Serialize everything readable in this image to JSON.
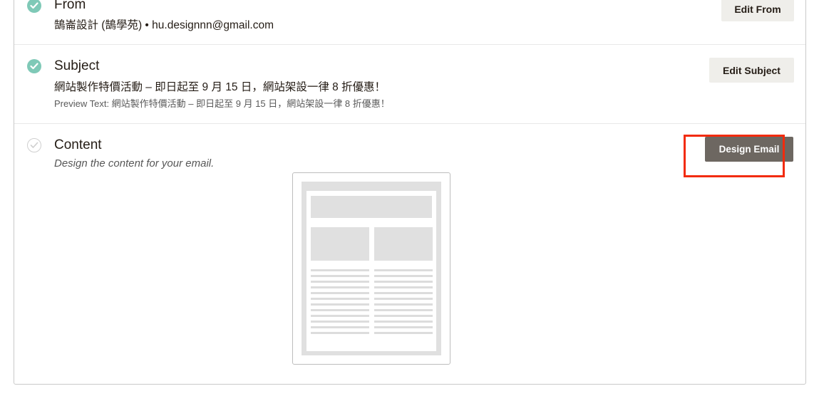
{
  "from": {
    "title": "From",
    "status": "complete",
    "detail": "鵠崙設計 (鵠學苑) • hu.designnn@gmail.com",
    "button_label": "Edit From"
  },
  "subject": {
    "title": "Subject",
    "status": "complete",
    "detail": "網站製作特價活動 – 即日起至 9 月 15 日，網站架設一律 8 折優惠！",
    "preview_text": "Preview Text: 網站製作特價活動 – 即日起至 9 月 15 日，網站架設一律 8 折優惠！",
    "button_label": "Edit Subject"
  },
  "content": {
    "title": "Content",
    "status": "incomplete",
    "description": "Design the content for your email.",
    "button_label": "Design Email",
    "preview_thumbnail": "two-column-email-template",
    "highlight_color": "#f22b0d"
  },
  "colors": {
    "complete": "#7fc9b7",
    "primary_button": "#6d6761",
    "secondary_button": "#efeeea"
  }
}
